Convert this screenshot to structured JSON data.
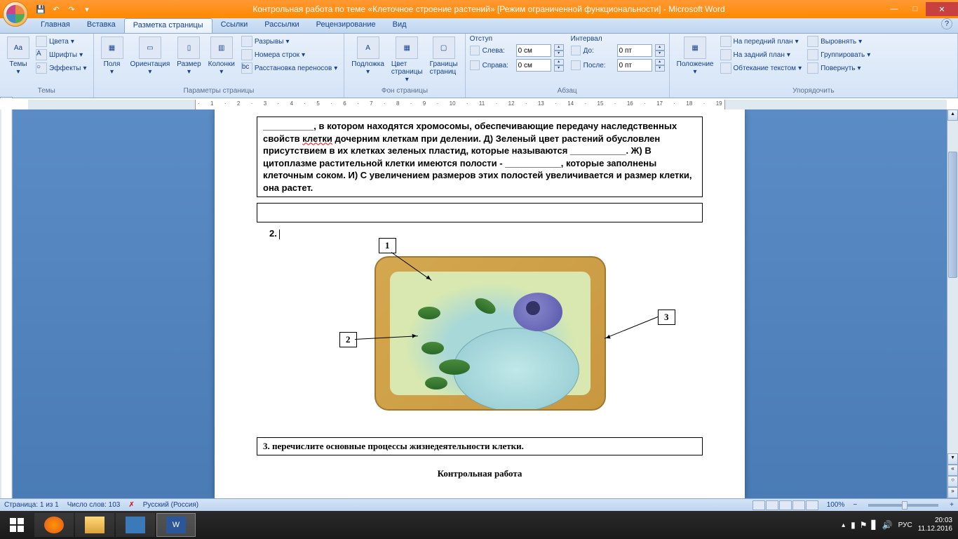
{
  "window": {
    "title": "Контрольная работа по теме «Клеточное строение растений» [Режим ограниченной функциональности] - Microsoft Word"
  },
  "qat": {
    "save": "💾",
    "undo": "↶",
    "redo": "↷"
  },
  "tabs": {
    "home": "Главная",
    "insert": "Вставка",
    "layout": "Разметка страницы",
    "references": "Ссылки",
    "mailings": "Рассылки",
    "review": "Рецензирование",
    "view": "Вид"
  },
  "ribbon": {
    "themes": {
      "label": "Темы",
      "themes_btn": "Темы",
      "colors": "Цвета",
      "fonts": "Шрифты",
      "effects": "Эффекты"
    },
    "page_setup": {
      "label": "Параметры страницы",
      "margins": "Поля",
      "orientation": "Ориентация",
      "size": "Размер",
      "columns": "Колонки",
      "breaks": "Разрывы",
      "line_numbers": "Номера строк",
      "hyphenation": "Расстановка переносов"
    },
    "page_bg": {
      "label": "Фон страницы",
      "watermark": "Подложка",
      "page_color": "Цвет\nстраницы",
      "borders": "Границы\nстраниц"
    },
    "paragraph": {
      "label": "Абзац",
      "indent_title": "Отступ",
      "spacing_title": "Интервал",
      "left": "Слева:",
      "right": "Справа:",
      "before": "До:",
      "after": "После:",
      "left_val": "0 см",
      "right_val": "0 см",
      "before_val": "0 пт",
      "after_val": "0 пт"
    },
    "arrange": {
      "label": "Упорядочить",
      "position": "Положение",
      "front": "На передний план",
      "back": "На задний план",
      "wrap": "Обтекание текстом",
      "align": "Выровнять",
      "group": "Группировать",
      "rotate": "Повернуть"
    }
  },
  "document": {
    "para1": "__________, в котором находятся хромосомы, обеспечивающие передачу наследственных свойств ",
    "para1_wavy": "клетки",
    "para1b": " дочерним клеткам при делении. Д) Зеленый цвет растений обусловлен присутствием в их клетках зеленых пластид, которые называются ___________. Ж) В цитоплазме растительной клетки имеются полости - ___________, которые заполнены клеточным соком. И) С увеличением размеров этих полостей увеличивается и размер клетки, она растет.",
    "q2": "2.",
    "label1": "1",
    "label2": "2",
    "label3": "3",
    "q3": "3.  перечислите основные процессы жизнедеятельности клетки.",
    "footer": "Контрольная работа"
  },
  "status": {
    "page": "Страница: 1 из 1",
    "words": "Число слов: 103",
    "lang": "Русский (Россия)",
    "zoom": "100%"
  },
  "taskbar": {
    "lang": "РУС",
    "time": "20:03",
    "date": "11.12.2016"
  }
}
